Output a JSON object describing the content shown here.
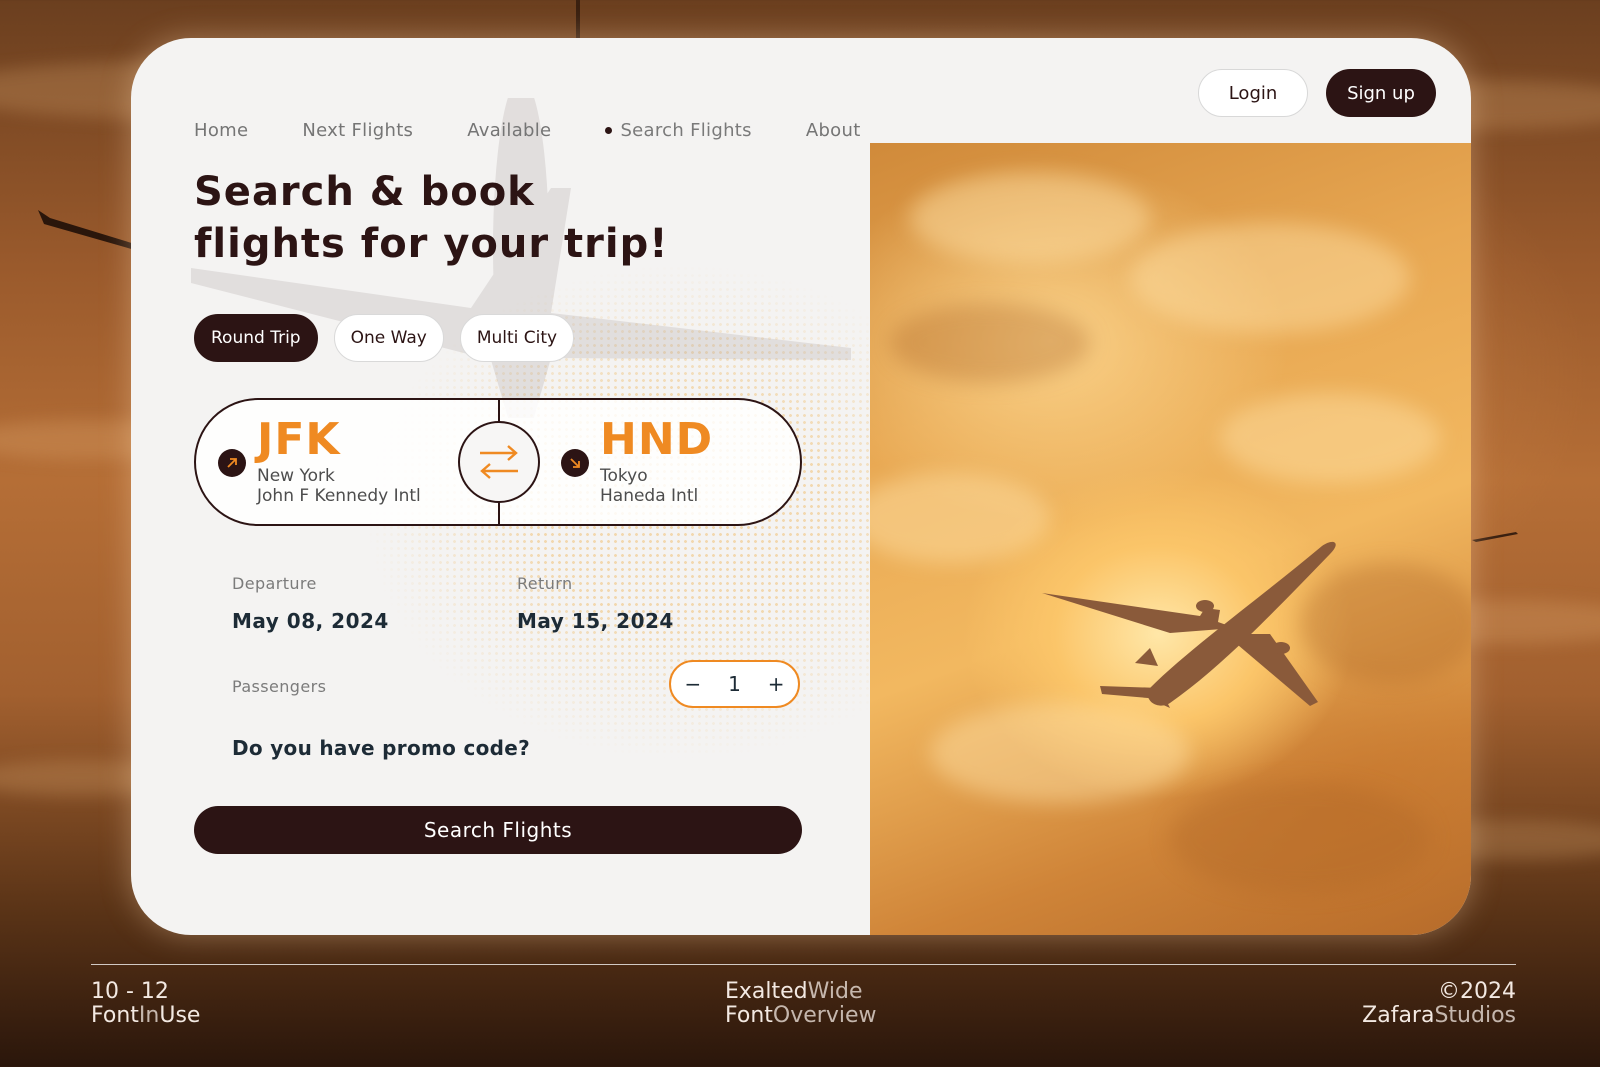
{
  "nav": {
    "items": [
      {
        "label": "Home"
      },
      {
        "label": "Next Flights"
      },
      {
        "label": "Available"
      },
      {
        "label": "Search Flights",
        "active": true
      },
      {
        "label": "About"
      }
    ],
    "login_label": "Login",
    "signup_label": "Sign up"
  },
  "hero": {
    "title_line1": "Search & book",
    "title_line2": "flights for your trip!"
  },
  "trip_types": [
    {
      "label": "Round Trip",
      "selected": true
    },
    {
      "label": "One Way",
      "selected": false
    },
    {
      "label": "Multi City",
      "selected": false
    }
  ],
  "route": {
    "from": {
      "code": "JFK",
      "city": "New York",
      "airport": "John F Kennedy Intl"
    },
    "to": {
      "code": "HND",
      "city": "Tokyo",
      "airport": "Haneda Intl"
    }
  },
  "dates": {
    "departure_label": "Departure",
    "departure_value": "May 08, 2024",
    "return_label": "Return",
    "return_value": "May 15, 2024"
  },
  "passengers": {
    "label": "Passengers",
    "count": "1",
    "minus": "−",
    "plus": "+"
  },
  "promo_text": "Do you have promo code?",
  "search_button_label": "Search Flights",
  "footer": {
    "left_line1": "10 - 12",
    "left_line2_a": "Font",
    "left_line2_b": "In",
    "left_line2_c": "Use",
    "mid_line1_a": "Exalted",
    "mid_line1_b": "Wide",
    "mid_line2_a": "Font",
    "mid_line2_b": "Overview",
    "right_line1": "©2024",
    "right_line2_a": "Zafara",
    "right_line2_b": "Studios"
  },
  "colors": {
    "brand_dark": "#2c1414",
    "accent_orange": "#ef8a22",
    "card_bg": "#f4f3f2"
  },
  "icons": [
    "arrow-up-right-icon",
    "swap-arrows-icon",
    "arrow-down-right-icon",
    "airplane-image"
  ]
}
